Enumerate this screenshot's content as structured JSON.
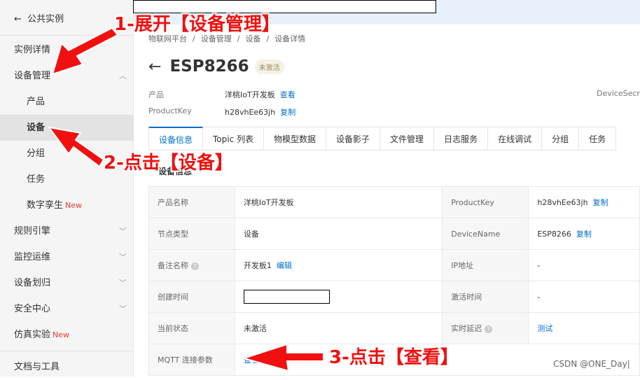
{
  "sidebar": {
    "back": "公共实例",
    "items": [
      {
        "label": "实例详情"
      },
      {
        "label": "设备管理"
      },
      {
        "label": "产品"
      },
      {
        "label": "设备"
      },
      {
        "label": "分组"
      },
      {
        "label": "任务"
      },
      {
        "label": "数字孪生",
        "badge": "New"
      },
      {
        "label": "规则引擎"
      },
      {
        "label": "监控运维"
      },
      {
        "label": "设备划归"
      },
      {
        "label": "安全中心"
      },
      {
        "label": "仿真实验",
        "badge": "New"
      },
      {
        "label": "文档与工具"
      }
    ]
  },
  "breadcrumb": [
    "物联网平台",
    "/",
    "设备管理",
    "/",
    "设备",
    "/",
    "设备详情"
  ],
  "device": {
    "name": "ESP8266",
    "status": "未激活"
  },
  "meta": {
    "product_label": "产品",
    "product_value": "洋桃IoT开发板",
    "product_link": "查看",
    "pk_label": "ProductKey",
    "pk_value": "h28vhEe63jh",
    "pk_link": "复制",
    "secret_label": "DeviceSecret"
  },
  "tabs": [
    "设备信息",
    "Topic 列表",
    "物模型数据",
    "设备影子",
    "文件管理",
    "日志服务",
    "在线调试",
    "分组",
    "任务"
  ],
  "section_title": "设备信息",
  "table": [
    [
      "产品名称",
      "洋桃IoT开发板",
      "",
      "ProductKey",
      "h28vhEe63jh",
      "复制"
    ],
    [
      "节点类型",
      "设备",
      "",
      "DeviceName",
      "ESP8266",
      "复制"
    ],
    [
      "备注名称",
      "开发板1",
      "编辑",
      "IP地址",
      "-",
      ""
    ],
    [
      "创建时间",
      "",
      "",
      "激活时间",
      "-",
      ""
    ],
    [
      "当前状态",
      "未激活",
      "",
      "实时延迟",
      "",
      "测试"
    ],
    [
      "MQTT 连接参数",
      "",
      "查看",
      "",
      "",
      ""
    ]
  ],
  "annotations": [
    "1-展开【设备管理】",
    "2-点击【设备】",
    "3-点击【查看】"
  ],
  "watermark": "CSDN @ONE_Day|",
  "colors": {
    "accent": "#0070cc",
    "annotation": "#f01010"
  }
}
